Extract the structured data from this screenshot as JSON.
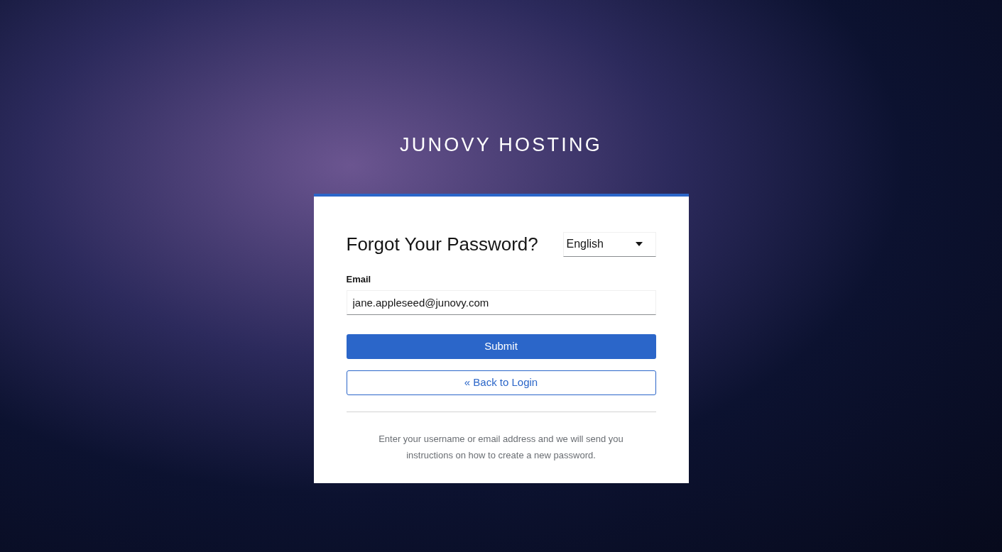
{
  "brand": {
    "title": "JUNOVY HOSTING"
  },
  "card": {
    "title": "Forgot Your Password?",
    "language": {
      "value": "English"
    },
    "email": {
      "label": "Email",
      "value": "jane.appleseed@junovy.com"
    },
    "buttons": [
      {
        "kind": "primary",
        "label": "Submit"
      },
      {
        "kind": "link",
        "label": "« Back to Login"
      }
    ],
    "info": "Enter your username or email address and we will send you instructions on how to create a new password."
  }
}
